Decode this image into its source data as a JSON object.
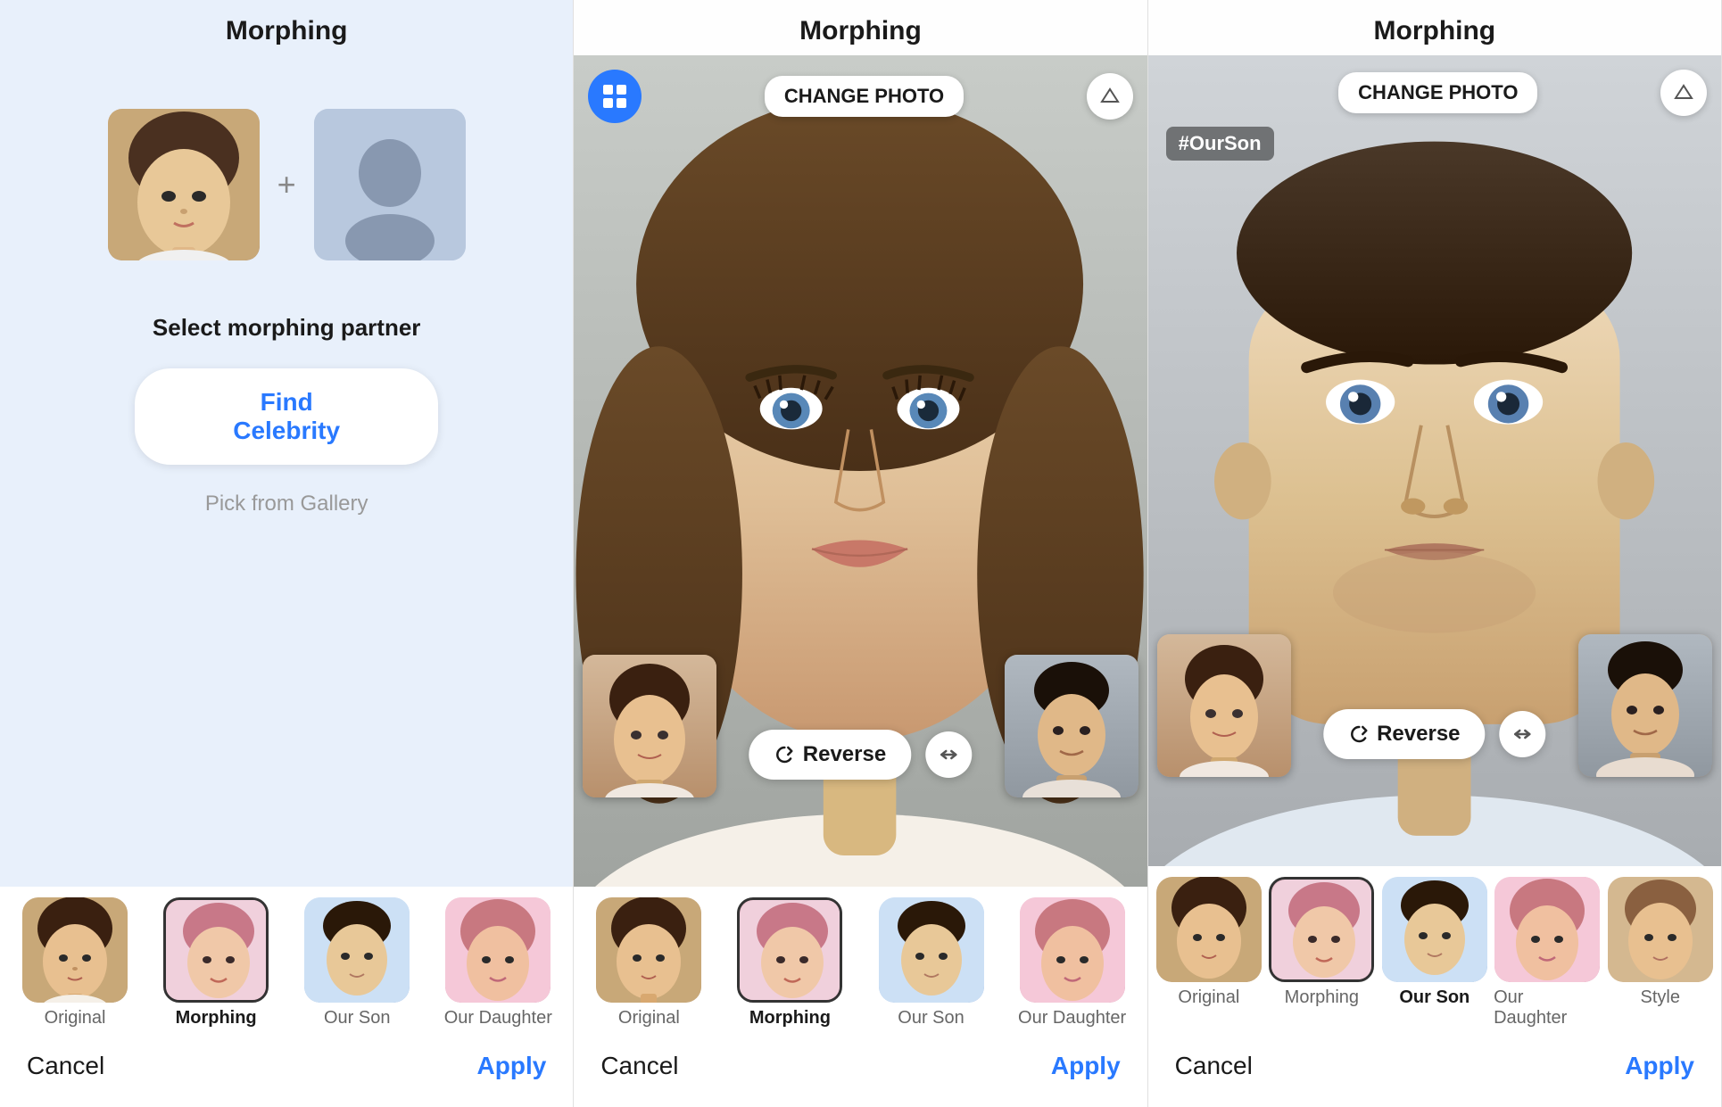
{
  "panels": [
    {
      "id": "panel1",
      "title": "Morphing",
      "bg": "light-blue",
      "select_label": "Select morphing partner",
      "find_celebrity_label": "Find Celebrity",
      "pick_gallery_label": "Pick from Gallery",
      "cancel_label": "Cancel",
      "apply_label": "Apply",
      "tabs": [
        {
          "id": "original",
          "label": "Original",
          "bold": false,
          "style": "original"
        },
        {
          "id": "morphing",
          "label": "Morphing",
          "bold": true,
          "style": "morphing"
        },
        {
          "id": "ourson",
          "label": "Our Son",
          "bold": false,
          "style": "ourson"
        },
        {
          "id": "ourdaughter",
          "label": "Our Daughter",
          "bold": false,
          "style": "ourdaughter"
        }
      ]
    },
    {
      "id": "panel2",
      "title": "Morphing",
      "bg": "photo",
      "change_photo_label": "CHANGE PHOTO",
      "reverse_label": "Reverse",
      "cancel_label": "Cancel",
      "apply_label": "Apply",
      "selected_tab": "Morphing",
      "tabs": [
        {
          "id": "original",
          "label": "Original",
          "bold": false,
          "style": "original"
        },
        {
          "id": "morphing",
          "label": "Morphing",
          "bold": true,
          "style": "morphing"
        },
        {
          "id": "ourson",
          "label": "Our Son",
          "bold": false,
          "style": "ourson"
        },
        {
          "id": "ourdaughter",
          "label": "Our Daughter",
          "bold": false,
          "style": "ourdaughter"
        }
      ]
    },
    {
      "id": "panel3",
      "title": "Morphing",
      "bg": "photo",
      "change_photo_label": "CHANGE PHOTO",
      "reverse_label": "Reverse",
      "cancel_label": "Cancel",
      "apply_label": "Apply",
      "hashtag": "#OurSon",
      "selected_tab": "Our Son",
      "tabs": [
        {
          "id": "original",
          "label": "Original",
          "bold": false,
          "style": "original"
        },
        {
          "id": "morphing",
          "label": "Morphing",
          "bold": false,
          "style": "morphing"
        },
        {
          "id": "ourson",
          "label": "Our Son",
          "bold": true,
          "style": "ourson"
        },
        {
          "id": "ourdaughter",
          "label": "Our Daughter",
          "bold": false,
          "style": "ourdaughter"
        },
        {
          "id": "style",
          "label": "Style",
          "bold": false,
          "style": "style"
        }
      ]
    }
  ],
  "icons": {
    "grid": "⊞",
    "eraser": "◇",
    "reverse": "↺",
    "expand": "↔"
  }
}
